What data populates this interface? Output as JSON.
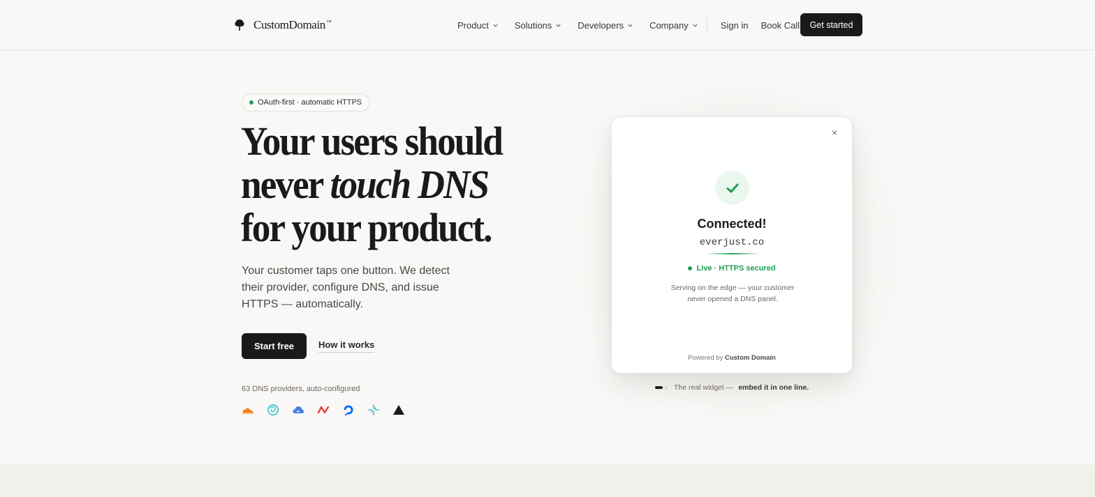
{
  "nav": {
    "logo_text": "CustomDomain",
    "logo_tm": "™",
    "menu": [
      {
        "label": "Product"
      },
      {
        "label": "Solutions"
      },
      {
        "label": "Developers"
      },
      {
        "label": "Company"
      }
    ],
    "sign_in": "Sign in",
    "book_call": "Book Call",
    "cta": "Get started"
  },
  "hero": {
    "badge": "OAuth-first · automatic HTTPS",
    "headline_line1": "Your users should",
    "headline_line2a": "never ",
    "headline_line2b": "touch DNS",
    "headline_line3": "for your product.",
    "lede": "Your customer taps one button. We detect their provider, configure DNS, and issue HTTPS — automatically.",
    "primary_cta": "Start free",
    "secondary_cta": "How it works",
    "providers_label": "63 DNS providers, auto-configured",
    "provider_icons": [
      "cloudflare-icon",
      "digitalocean-swirl-icon",
      "google-cloud-icon",
      "netlify-n-icon",
      "digitalocean-icon",
      "squarespace-icon",
      "vercel-icon"
    ]
  },
  "widget": {
    "close": "×",
    "status_title": "Connected!",
    "domain": "everjust.co",
    "live": "Live · HTTPS secured",
    "serving": "Serving on the edge — your customer never opened a DNS panel.",
    "powered_prefix": "Powered by ",
    "powered_brand": "Custom Domain",
    "caption_prefix": "The real widget —",
    "caption_bold": "embed it in one line."
  },
  "colors": {
    "background": "#f9f8f6",
    "ink": "#1c1a19",
    "success": "#1f9d55"
  }
}
